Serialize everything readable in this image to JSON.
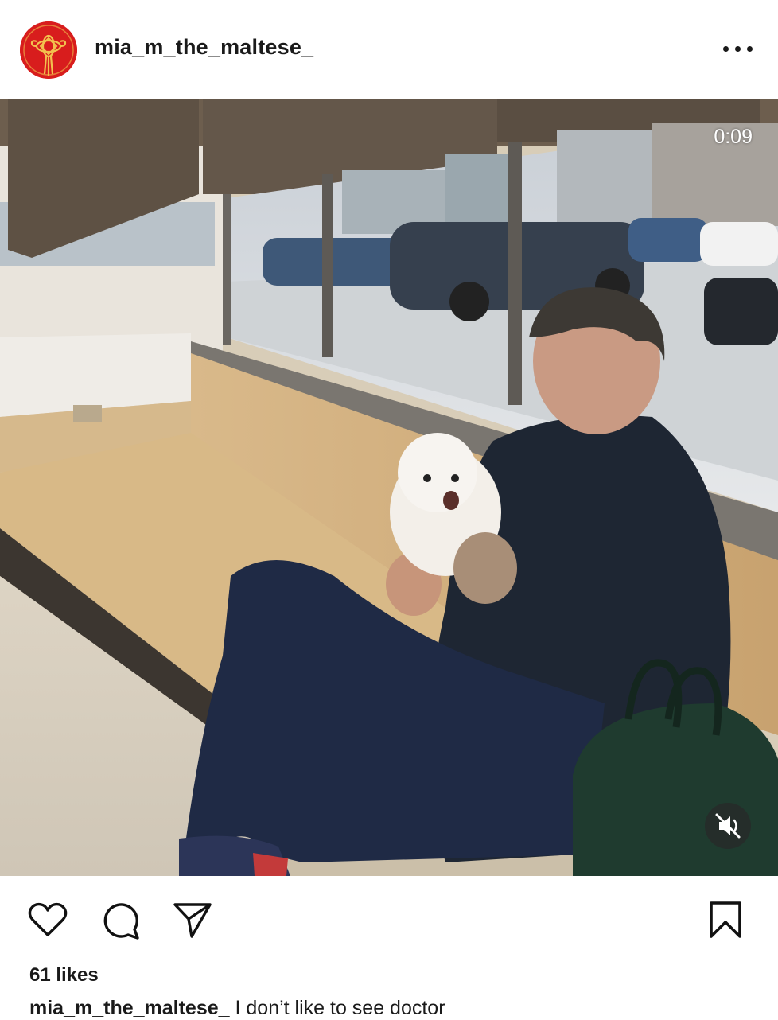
{
  "post": {
    "username": "mia_m_the_maltese_",
    "video_time": "0:09",
    "likes": "61 likes",
    "caption_user": "mia_m_the_maltese_",
    "caption_text": "I don’t like to see doctor"
  },
  "icons": {
    "avatar": "red-knot-logo",
    "more": "more-options-icon",
    "mute": "sound-off-icon",
    "like": "heart-icon",
    "comment": "comment-icon",
    "share": "send-icon",
    "save": "bookmark-icon"
  },
  "colors": {
    "avatar_bg": "#d81d1d",
    "avatar_knot": "#f2c14e",
    "text": "#1a1a1a"
  }
}
